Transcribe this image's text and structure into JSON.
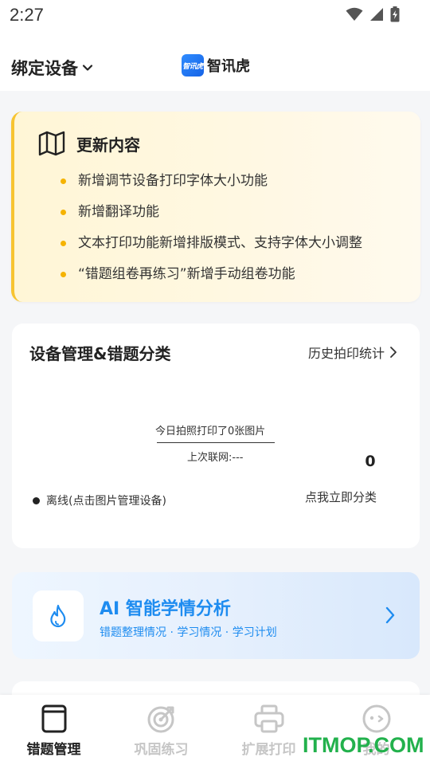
{
  "status_bar": {
    "time": "2:27"
  },
  "header": {
    "bind_device_label": "绑定设备",
    "brand_logo_text": "智讯虎",
    "brand_name": "智讯虎"
  },
  "update": {
    "title": "更新内容",
    "items": [
      "新增调节设备打印字体大小功能",
      "新增翻译功能",
      "文本打印功能新增排版模式、支持字体大小调整",
      "“错题组卷再练习”新增手动组卷功能"
    ]
  },
  "device": {
    "title": "设备管理&错题分类",
    "history_link": "历史拍印统计",
    "today_text": "今日拍照打印了0张图片",
    "last_online": "上次联网:---",
    "count": "0",
    "classify_link": "点我立即分类",
    "offline_text": "离线(点击图片管理设备)"
  },
  "ai": {
    "title": "AI 智能学情分析",
    "subtitle": "错题整理情况 · 学习情况 · 学习计划"
  },
  "tabs": [
    {
      "label": "错题管理",
      "icon": "notebook-icon",
      "active": true
    },
    {
      "label": "巩固练习",
      "icon": "target-icon",
      "active": false
    },
    {
      "label": "扩展打印",
      "icon": "printer-icon",
      "active": false
    },
    {
      "label": "我的",
      "icon": "face-icon",
      "active": false
    }
  ],
  "watermark": "ITMOP.COM",
  "colors": {
    "accent_blue": "#1e8cf0",
    "update_bullet": "#f5b300",
    "update_border": "#f7c431",
    "watermark_green": "#22b14c"
  }
}
